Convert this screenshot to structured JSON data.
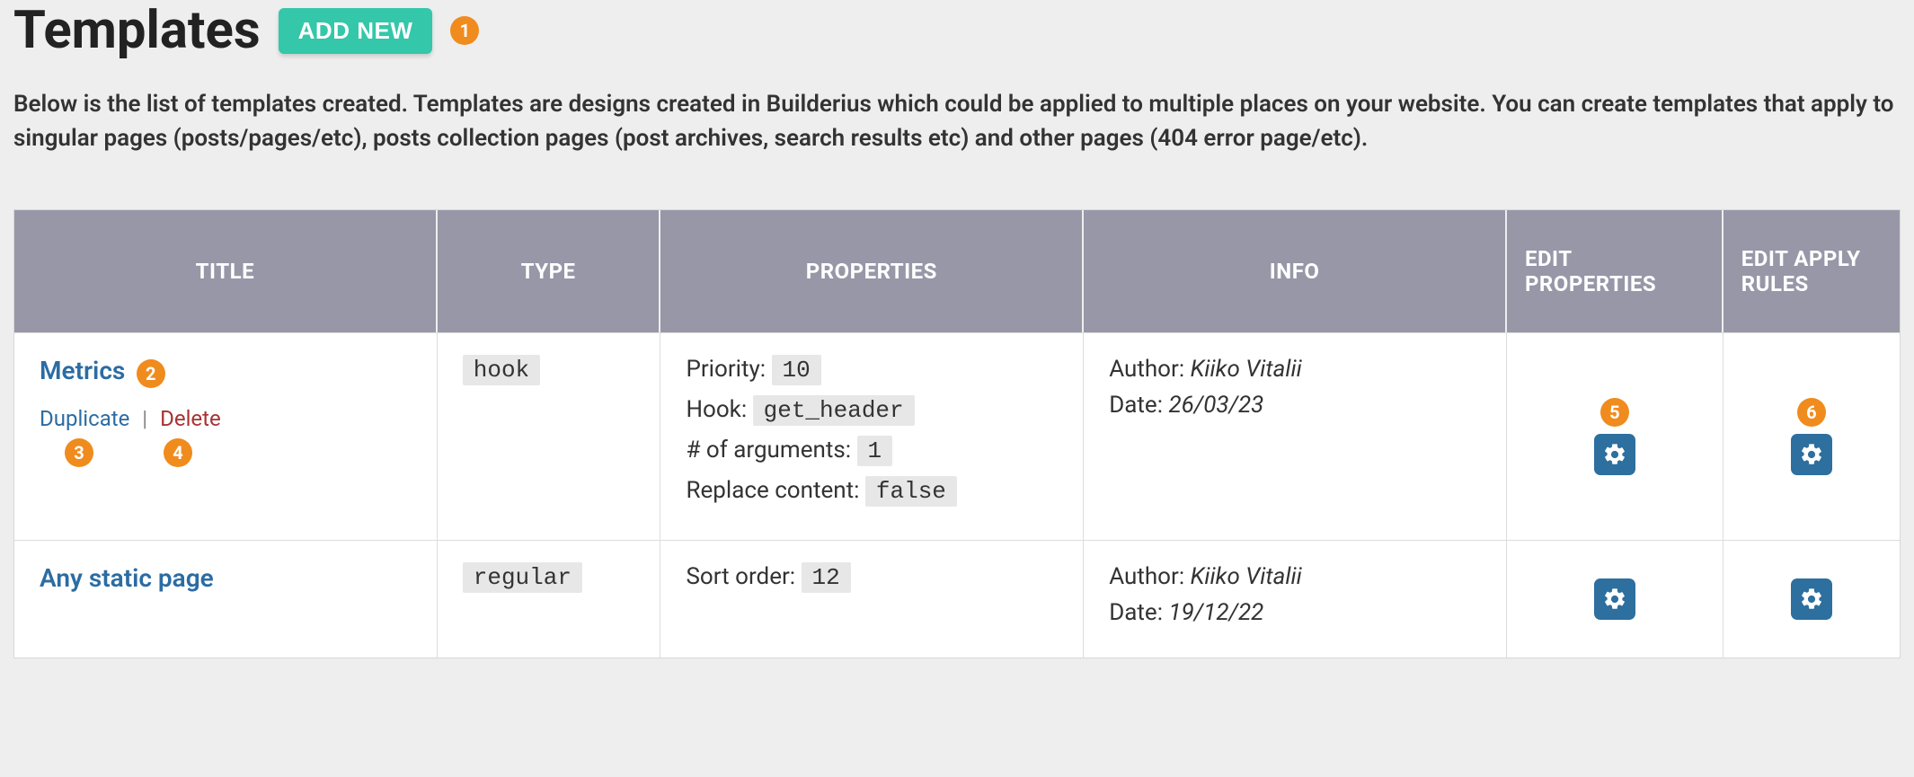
{
  "page_title": "Templates",
  "add_new_label": "ADD NEW",
  "description": "Below is the list of templates created. Templates are designs created in Builderius which could be applied to multiple places on your website. You can create templates that apply to singular pages (posts/pages/etc), posts collection pages (post archives, search results etc) and other pages (404 error page/etc).",
  "callouts": {
    "c1": "1",
    "c2": "2",
    "c3": "3",
    "c4": "4",
    "c5": "5",
    "c6": "6"
  },
  "table": {
    "headers": {
      "title": "TITLE",
      "type": "TYPE",
      "properties": "PROPERTIES",
      "info": "INFO",
      "edit_properties": "EDIT PROPERTIES",
      "edit_apply_rules": "EDIT APPLY RULES"
    },
    "actions": {
      "duplicate": "Duplicate",
      "delete": "Delete",
      "separator": "|"
    },
    "rows": [
      {
        "title": "Metrics",
        "type": "hook",
        "props": {
          "priority_label": "Priority:",
          "priority_value": "10",
          "hook_label": "Hook:",
          "hook_value": "get_header",
          "args_label": "# of arguments:",
          "args_value": "1",
          "replace_label": "Replace content:",
          "replace_value": "false"
        },
        "info": {
          "author_label": "Author:",
          "author_value": "Kiiko Vitalii",
          "date_label": "Date:",
          "date_value": "26/03/23"
        }
      },
      {
        "title": "Any static page",
        "type": "regular",
        "props": {
          "sort_label": "Sort order:",
          "sort_value": "12"
        },
        "info": {
          "author_label": "Author:",
          "author_value": "Kiiko Vitalii",
          "date_label": "Date:",
          "date_value": "19/12/22"
        }
      }
    ]
  }
}
